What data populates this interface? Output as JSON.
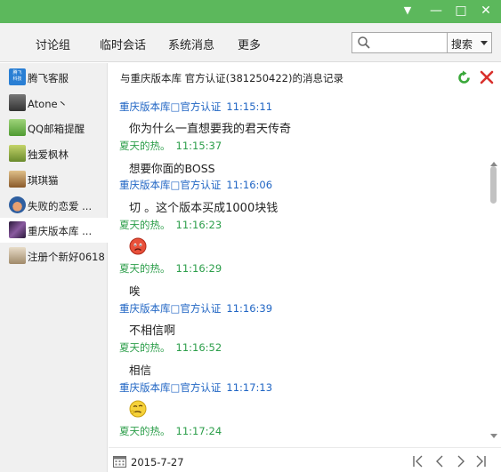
{
  "window_controls": {
    "menu_glyph": "▼",
    "minimize_glyph": "—",
    "maximize_glyph": "□",
    "close_glyph": "✕"
  },
  "toolbar": {
    "tabs": [
      {
        "label": "讨论组"
      },
      {
        "label": "临时会话"
      },
      {
        "label": "系统消息"
      },
      {
        "label": "更多"
      }
    ],
    "search": {
      "placeholder": "",
      "button_label": "搜索"
    }
  },
  "sidebar": {
    "contacts": [
      {
        "name": "腾飞客服",
        "avatar_color": "#2a7fd4",
        "avatar_text": "腾飞\n科技"
      },
      {
        "name": "Atone丶",
        "avatar_color": "#555555",
        "avatar_text": ""
      },
      {
        "name": "QQ邮箱提醒",
        "avatar_color": "#6bb04a",
        "avatar_text": ""
      },
      {
        "name": "独爱枫林",
        "avatar_color": "#8a9f3c",
        "avatar_text": ""
      },
      {
        "name": "琪琪猫",
        "avatar_color": "#b88a4a",
        "avatar_text": ""
      },
      {
        "name": "失败的恋爱 ...",
        "avatar_color": "#3a6fb0",
        "avatar_text": ""
      },
      {
        "name": "重庆版本库 ...",
        "avatar_color": "#5a3a6a",
        "avatar_text": "",
        "selected": true
      },
      {
        "name": "注册个新好0618",
        "avatar_color": "#c9b49a",
        "avatar_text": ""
      }
    ]
  },
  "chat": {
    "title": "与重庆版本库  官方认证(381250422)的消息记录",
    "messages": [
      {
        "sender": "重庆版本库□官方认证",
        "time": "11:15:11",
        "kind": "other",
        "text": "你为什么一直想要我的君天传奇"
      },
      {
        "sender": "夏天的热。",
        "time": "11:15:37",
        "kind": "self",
        "text": "想要你面的BOSS"
      },
      {
        "sender": "重庆版本库□官方认证",
        "time": "11:16:06",
        "kind": "other",
        "text": "切 。这个版本买成1000块钱"
      },
      {
        "sender": "夏天的热。",
        "time": "11:16:23",
        "kind": "self",
        "emoji": "angry-face"
      },
      {
        "sender": "夏天的热。",
        "time": "11:16:29",
        "kind": "self",
        "text": "唉"
      },
      {
        "sender": "重庆版本库□官方认证",
        "time": "11:16:39",
        "kind": "other",
        "text": "不相信啊"
      },
      {
        "sender": "夏天的热。",
        "time": "11:16:52",
        "kind": "self",
        "text": "相信"
      },
      {
        "sender": "重庆版本库□官方认证",
        "time": "11:17:13",
        "kind": "other",
        "emoji": "thinking-face"
      },
      {
        "sender": "夏天的热。",
        "time": "11:17:24",
        "kind": "self"
      }
    ]
  },
  "footer": {
    "date": "2015-7-27",
    "pager": [
      "|<",
      "<",
      ">",
      ">|"
    ]
  },
  "colors": {
    "titlebar": "#5cb85c",
    "other_sender": "#2166c4",
    "self_sender": "#2c9e4a",
    "refresh": "#3aa83a",
    "delete": "#d9302c"
  }
}
